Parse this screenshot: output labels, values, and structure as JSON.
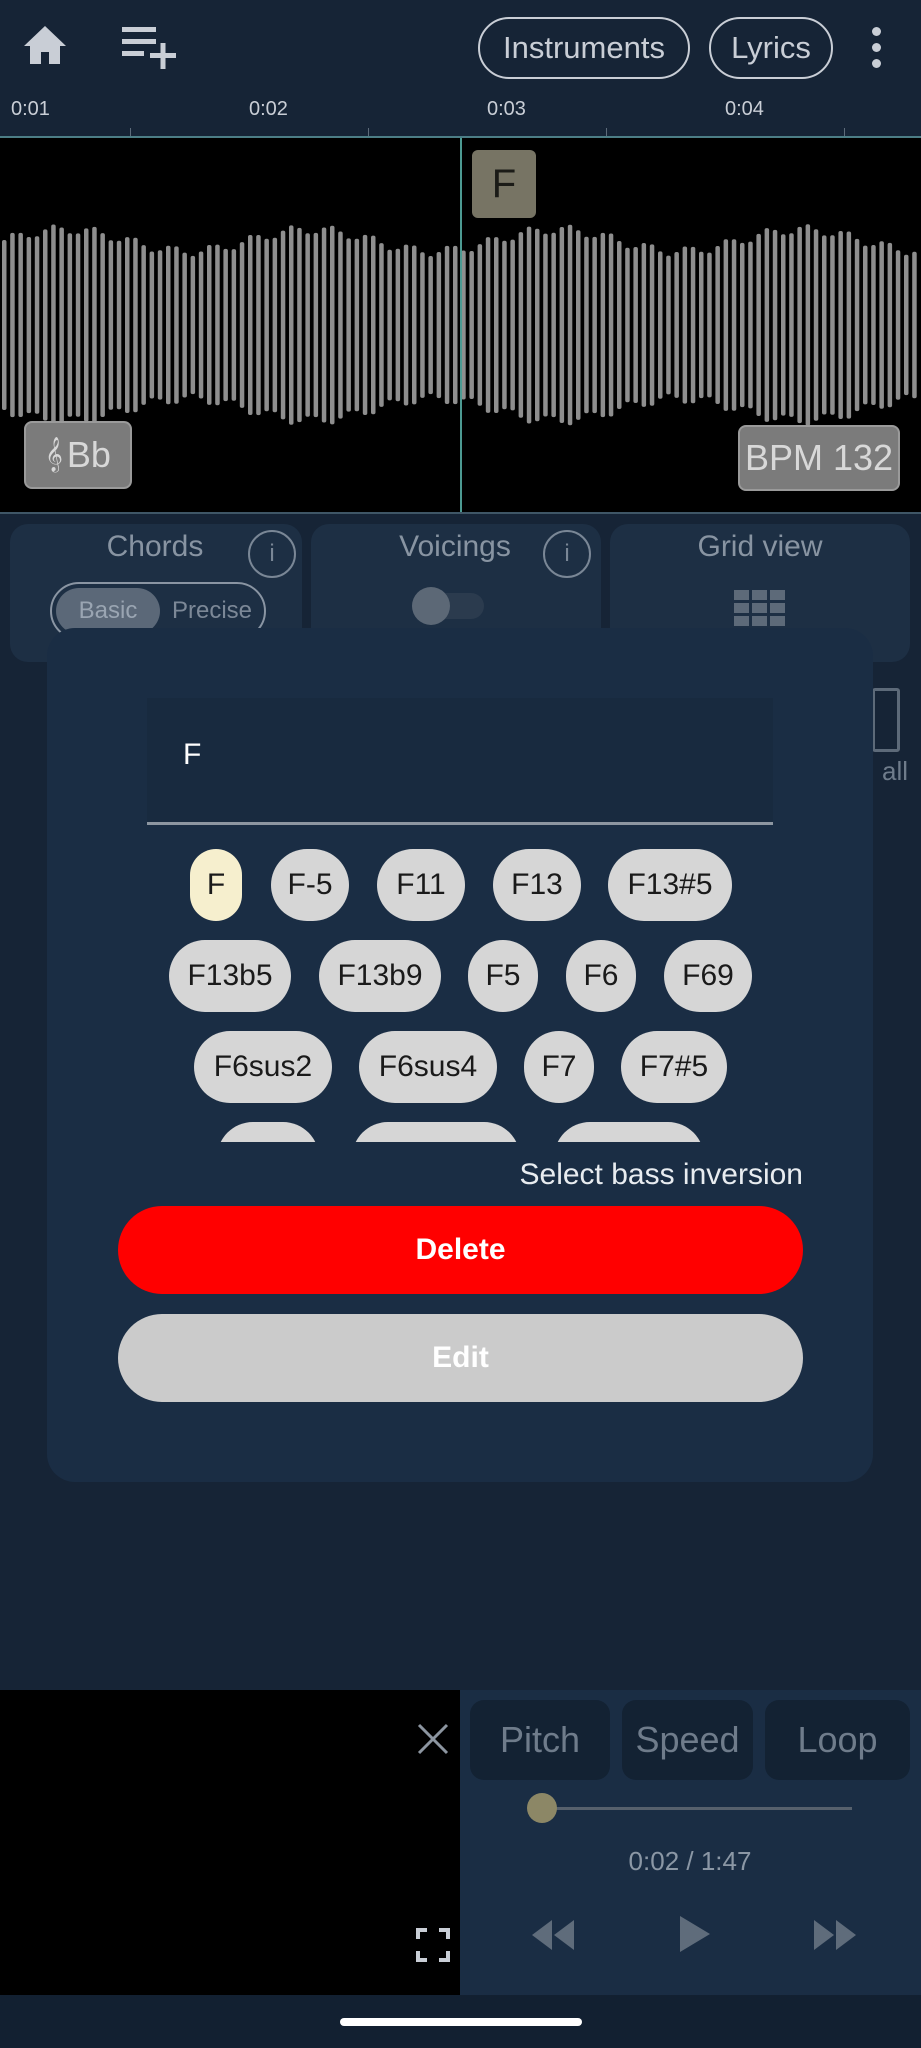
{
  "topbar": {
    "home_icon": "home-icon",
    "playlist_add_icon": "playlist-add-icon",
    "instruments_label": "Instruments",
    "lyrics_label": "Lyrics",
    "more_icon": "more-vert-icon"
  },
  "timeline": {
    "labels": [
      "0:01",
      "0:02",
      "0:03",
      "0:04"
    ]
  },
  "waveform": {
    "chord_marker": "F",
    "key_label": "Bb",
    "key_icon": "treble-clef-icon",
    "bpm_label": "BPM 132"
  },
  "controls": {
    "chords_title": "Chords",
    "chords_mode_basic": "Basic",
    "chords_mode_precise": "Precise",
    "voicings_title": "Voicings",
    "grid_title": "Grid view",
    "partial_all": "all",
    "info_icon": "info-icon",
    "grid_icon": "grid-icon"
  },
  "dialog": {
    "chord_value": "F",
    "chips": [
      [
        "F",
        "F-5",
        "F11",
        "F13",
        "F13#5"
      ],
      [
        "F13b5",
        "F13b9",
        "F5",
        "F6",
        "F69"
      ],
      [
        "F6sus2",
        "F6sus4",
        "F7",
        "F7#5"
      ]
    ],
    "selected_chip": "F",
    "bass_inversion_label": "Select bass inversion",
    "delete_label": "Delete",
    "edit_label": "Edit",
    "colors": {
      "delete": "#ff0000",
      "edit": "#cbcbcb",
      "selected_chip": "#f6efce"
    }
  },
  "player": {
    "pitch_label": "Pitch",
    "speed_label": "Speed",
    "loop_label": "Loop",
    "position_fraction": 0.0187,
    "time_label": "0:02 / 1:47",
    "rewind_icon": "rewind-icon",
    "play_icon": "play-icon",
    "fast_forward_icon": "fast-forward-icon",
    "close_icon": "close-icon",
    "fullscreen_icon": "fullscreen-icon"
  }
}
